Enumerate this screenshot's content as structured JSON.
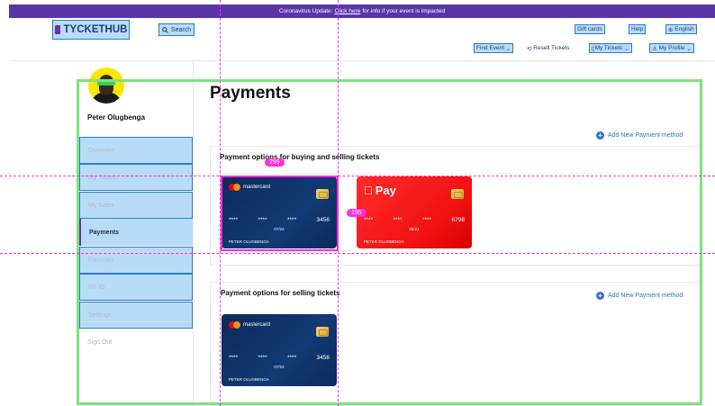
{
  "banner": {
    "prefix": "Coronavirus Update:",
    "link": "Click here",
    "suffix": "for info if your event is impacted"
  },
  "header": {
    "logo": "TYCKETHUB",
    "search": "Search",
    "gift_cards": "Gift cards",
    "help": "Help",
    "language": "English",
    "find_event": "Find Event",
    "resell": "Resell Tickets",
    "my_tickets": "My Tickets",
    "my_profile": "My Profile"
  },
  "user": {
    "name": "Peter Olugbenga"
  },
  "sidebar": {
    "items": [
      {
        "label": "Overview"
      },
      {
        "label": "My Tickets"
      },
      {
        "label": "My Sales"
      },
      {
        "label": "Payments"
      },
      {
        "label": "Favorites"
      },
      {
        "label": "RF ID"
      },
      {
        "label": "Settings"
      },
      {
        "label": "Sign Out"
      }
    ]
  },
  "main": {
    "title": "Payments",
    "buying_section": {
      "title": "Payment options for buying  and selling tickets",
      "add_label": "Add New Payment method",
      "cards": [
        {
          "brand": "mastercard",
          "number": [
            "****",
            "****",
            "****",
            "3456"
          ],
          "expiry": "07/22",
          "holder": "PETER OLUGBENGA"
        },
        {
          "brand": "Pay",
          "number": [
            "****",
            "****",
            "****",
            "6798"
          ],
          "expiry": "05/21",
          "holder": "PETER OLUGBENGA"
        }
      ]
    },
    "selling_section": {
      "title": "Payment options for selling tickets",
      "add_label": "Add New Payment method",
      "cards": [
        {
          "brand": "mastercard",
          "number": [
            "****",
            "****",
            "****",
            "3456"
          ],
          "expiry": "07/22",
          "holder": "PETER OLUGBENGA"
        }
      ]
    }
  },
  "measure": {
    "width_label": "299",
    "height_label": "195"
  },
  "colors": {
    "banner": "#5a35a8",
    "accent": "#2f6fd1",
    "card_navy": "#0c2a5b",
    "card_red": "#ff2b2b",
    "guide": "#ff2cdc",
    "frame": "#7ee27e"
  }
}
